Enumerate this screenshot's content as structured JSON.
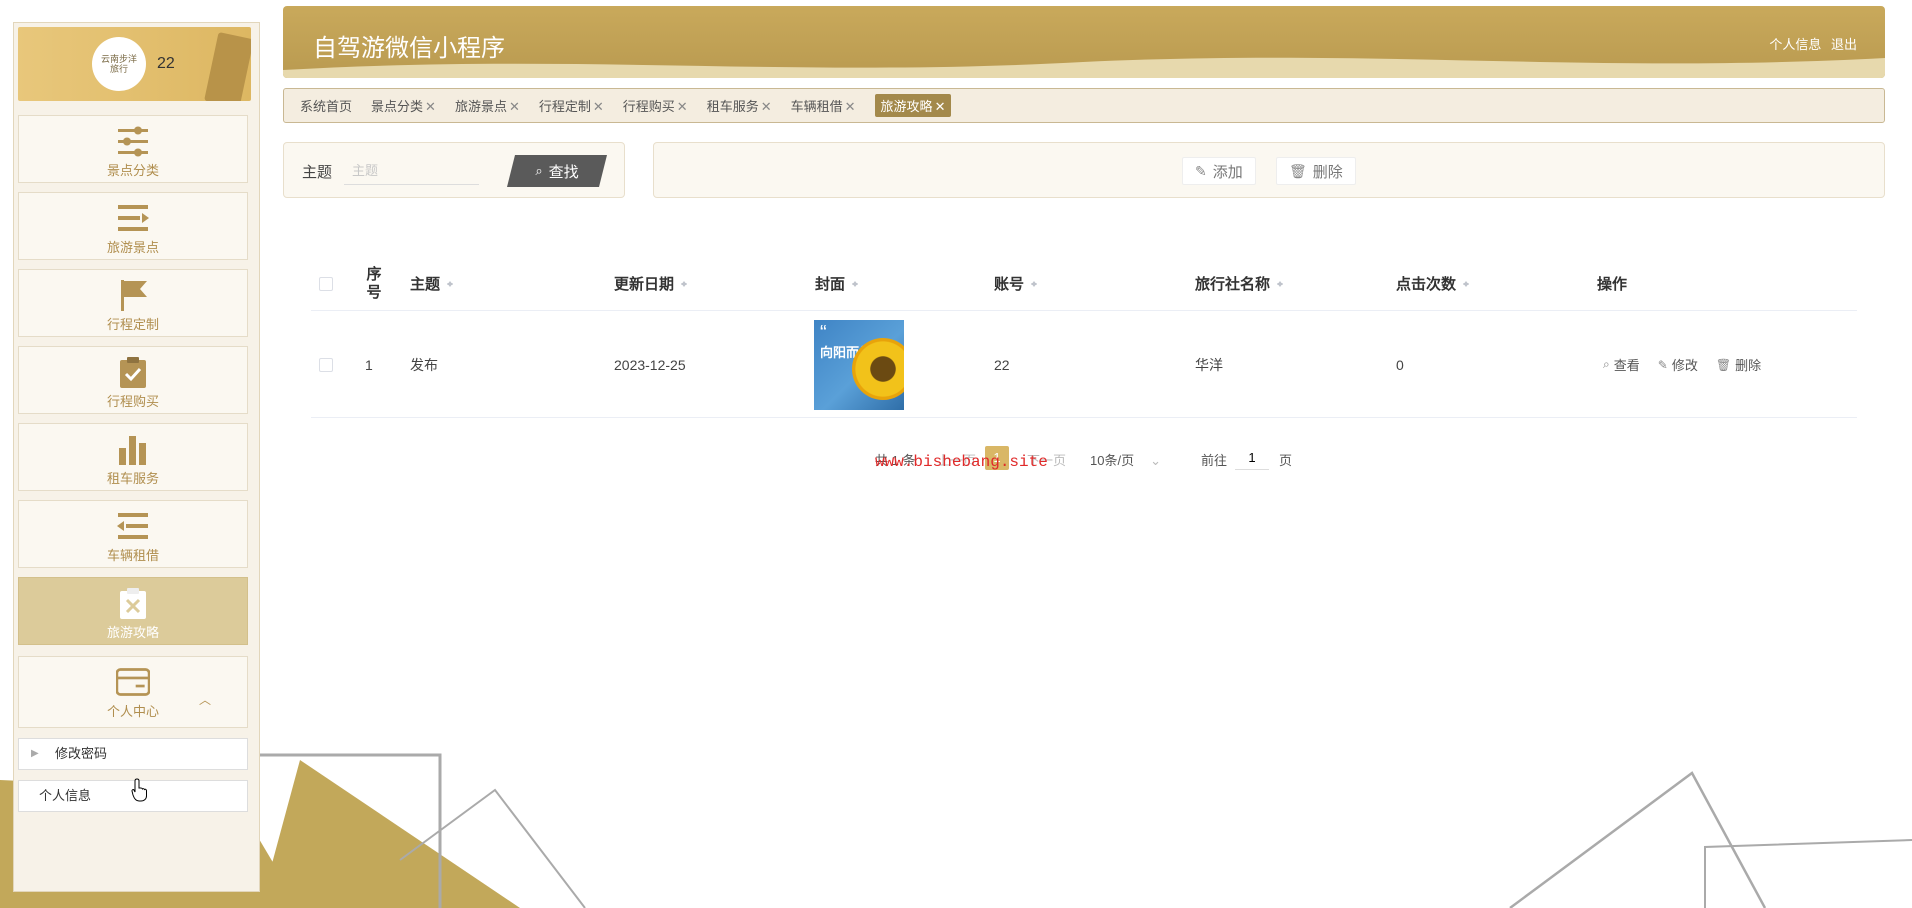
{
  "app": {
    "title": "自驾游微信小程序",
    "header_links": [
      "个人信息",
      "退出"
    ]
  },
  "sidebar": {
    "avatar_text": "云南步洋旅行",
    "username": "22",
    "items": [
      {
        "label": "景点分类",
        "icon": "sliders-icon",
        "active": false
      },
      {
        "label": "旅游景点",
        "icon": "list-indent-icon",
        "active": false
      },
      {
        "label": "行程定制",
        "icon": "flag-icon",
        "active": false
      },
      {
        "label": "行程购买",
        "icon": "clipboard-check-icon",
        "active": false
      },
      {
        "label": "租车服务",
        "icon": "bar-chart-icon",
        "active": false
      },
      {
        "label": "车辆租借",
        "icon": "list-outdent-icon",
        "active": false
      },
      {
        "label": "旅游攻略",
        "icon": "clipboard-x-icon",
        "active": true
      },
      {
        "label": "个人中心",
        "icon": "card-icon",
        "active": false,
        "expanded": true
      }
    ],
    "subitems": [
      "修改密码",
      "个人信息"
    ]
  },
  "tabs": [
    {
      "label": "系统首页",
      "closable": false
    },
    {
      "label": "景点分类",
      "closable": true
    },
    {
      "label": "旅游景点",
      "closable": true
    },
    {
      "label": "行程定制",
      "closable": true
    },
    {
      "label": "行程购买",
      "closable": true
    },
    {
      "label": "租车服务",
      "closable": true
    },
    {
      "label": "车辆租借",
      "closable": true
    },
    {
      "label": "旅游攻略",
      "closable": true,
      "active": true
    }
  ],
  "search": {
    "label": "主题",
    "placeholder": "主题",
    "value": "",
    "button": "查找"
  },
  "actions": {
    "add": "添加",
    "delete": "删除"
  },
  "table": {
    "columns": [
      "序号",
      "主题",
      "更新日期",
      "封面",
      "账号",
      "旅行社名称",
      "点击次数",
      "操作"
    ],
    "rows": [
      {
        "index": "1",
        "subject": "发布",
        "date": "2023-12-25",
        "cover_text": "向阳而生",
        "account": "22",
        "agency": "华洋",
        "clicks": "0"
      }
    ],
    "row_ops": [
      "查看",
      "修改",
      "删除"
    ]
  },
  "pagination": {
    "total": "共 1 条",
    "prev": "上一页",
    "page": "1",
    "next": "下一页",
    "page_size": "10条/页",
    "goto_label": "前往",
    "goto_value": "1",
    "goto_suffix": "页"
  },
  "watermark": "www.bishebang.site",
  "colors": {
    "accent": "#c9a95b",
    "active_tab": "#a3894b",
    "sidebar_active": "#dccb9a",
    "page_active": "#d9b766",
    "watermark": "#e02a2a"
  }
}
